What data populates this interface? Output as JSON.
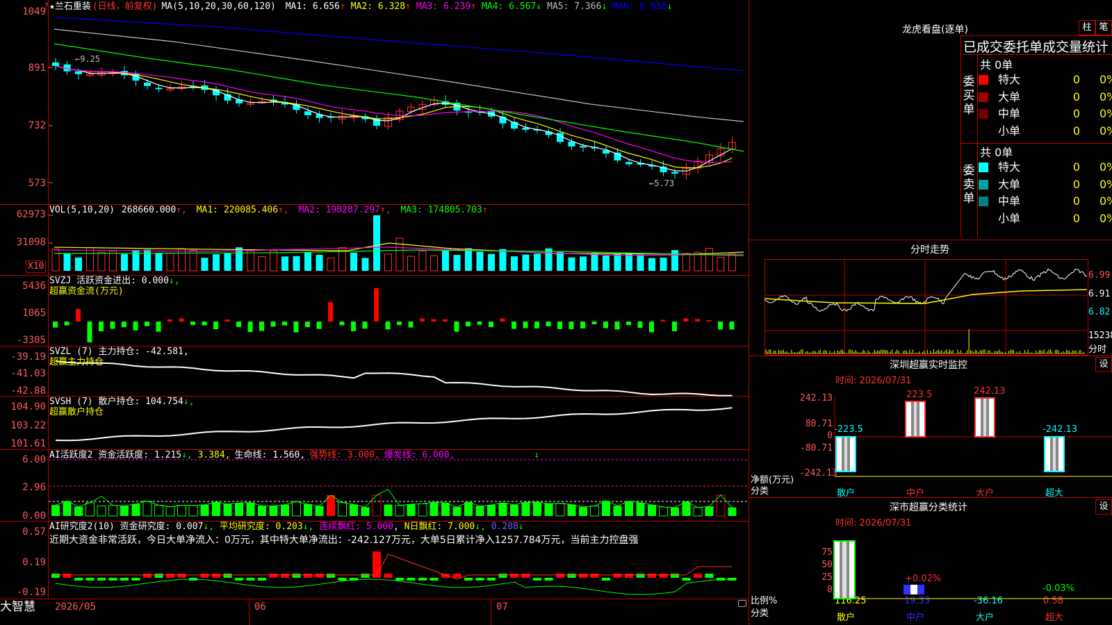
{
  "app": {
    "logo": "大智慧"
  },
  "stock": {
    "name": "★兰石重装",
    "mode": "(日线，前复权)",
    "ma_params": "MA(5,10,20,30,60,120)",
    "ma": [
      {
        "label": "MA1: 6.656",
        "arrow": "↑",
        "color": "#ffffff"
      },
      {
        "label": "MA2: 6.328",
        "arrow": "↑",
        "color": "#ffff00"
      },
      {
        "label": "MA3: 6.239",
        "arrow": "↑",
        "color": "#ff00ff"
      },
      {
        "label": "MA4: 6.567",
        "arrow": "↓",
        "color": "#00ff00"
      },
      {
        "label": "MA5: 7.366",
        "arrow": "↓",
        "color": "#c0c0c0"
      },
      {
        "label": "MA6: 8.838",
        "arrow": "↓",
        "color": "#0000ff"
      }
    ],
    "price_axis": [
      "1049",
      "891",
      "732",
      "573"
    ],
    "high_marker": "←9.25",
    "low_marker": "←5.73"
  },
  "volume": {
    "params": "VOL(5,10,20)",
    "value": "268660.000",
    "ma1": "MA1: 220085.406",
    "ma2": "MA2: 198287.297",
    "ma3": "MA3: 174805.703",
    "axis": [
      "62973",
      "31098"
    ],
    "unit": "X10"
  },
  "svzj": {
    "title": "SVZJ  活跃资金进出: 0.000",
    "arrow": "↓,",
    "subtitle": "超赢资金流(万元)",
    "axis": [
      "5436",
      "1065",
      "-3305"
    ]
  },
  "svzl": {
    "title": "SVZL (7) 主力持仓: -42.581,",
    "subtitle": "超赢主力持仓",
    "axis": [
      "-39.19",
      "-41.03",
      "-42.88"
    ]
  },
  "svsh": {
    "title": "SVSH (7) 散户持仓: 104.754",
    "arrow": "↓,",
    "subtitle": "超赢散户持仓",
    "axis": [
      "104.90",
      "103.22",
      "101.61"
    ]
  },
  "ai_active": {
    "title": "AI活跃度2 资金活跃度: 1.215",
    "v2": "3.384,",
    "life": "生命线: 1.560,",
    "strong": "强势线: 3.000,",
    "burst": "爆发线: 6.000,",
    "axis": [
      "6.00",
      "2.96",
      "0.00"
    ]
  },
  "ai_research": {
    "title": "AI研究度2(10) 资金研究度: 0.007",
    "avg": "平均研究度: 0.203",
    "red": "连续飘红: 5.000",
    "nred": "N日飘红: 7.000",
    "last": "0.208",
    "summary": "近期大资金非常活跃，今日大单净流入：0万元，其中特大单净流出：-242.127万元，大单5日累计净入1257.784万元，当前主力控盘强",
    "axis": [
      "0.57",
      "0.19",
      "-0.19"
    ]
  },
  "dates": [
    "2026/05",
    "06",
    "07"
  ],
  "right": {
    "header": "龙虎看盘(逐单)",
    "tab1": "柱",
    "tab2": "笔",
    "order_title": "已成交委托单成交量统计",
    "buy_label": "委买单",
    "sell_label": "委卖单",
    "buy_total": "共 0单",
    "sell_total": "共 0单",
    "buy_rows": [
      {
        "name": "特大",
        "num": "0",
        "pct": "0%",
        "color": "#ff0000"
      },
      {
        "name": "大单",
        "num": "0",
        "pct": "0%",
        "color": "#a00000"
      },
      {
        "name": "中单",
        "num": "0",
        "pct": "0%",
        "color": "#700000"
      },
      {
        "name": "小单",
        "num": "0",
        "pct": "0%",
        "color": "#000000"
      }
    ],
    "sell_rows": [
      {
        "name": "特大",
        "num": "0",
        "pct": "0%",
        "color": "#00ffff"
      },
      {
        "name": "大单",
        "num": "0",
        "pct": "0%",
        "color": "#00a0a0"
      },
      {
        "name": "中单",
        "num": "0",
        "pct": "0%",
        "color": "#008080"
      },
      {
        "name": "小单",
        "num": "0",
        "pct": "0%",
        "color": "#000000"
      }
    ],
    "intraday_title": "分时走势",
    "intraday_axis": [
      "6.99",
      "6.91",
      "6.82",
      "15238"
    ],
    "intraday_unit": "分时",
    "monitor_title": "深圳超赢实时监控",
    "monitor_btn": "设",
    "monitor_time": "时间: 2026/07/31",
    "monitor_axis": [
      "242.13",
      "80.71",
      "0",
      "-80.71",
      "-242.13"
    ],
    "monitor_ylabel": "净额(万元)",
    "monitor_xlabel": "分类",
    "monitor_bar_labels": [
      "-223.5",
      "223.5",
      "242.13",
      "-242.13"
    ],
    "monitor_cats": [
      "散户",
      "中户",
      "大户",
      "超大"
    ],
    "stat_title": "深市超赢分类统计",
    "stat_btn": "设",
    "stat_time": "时间: 2026/07/31",
    "stat_axis": [
      "75",
      "50",
      "25",
      "0"
    ],
    "stat_ylabel": "比例%",
    "stat_xlabel": "分类",
    "stat_bar_labels": [
      "+0.02%",
      "-0.03%"
    ],
    "stat_values": [
      "116.25",
      "19.33",
      "-36.16",
      "0.58"
    ],
    "stat_cats": [
      "散户",
      "中户",
      "大户",
      "超大"
    ]
  }
}
